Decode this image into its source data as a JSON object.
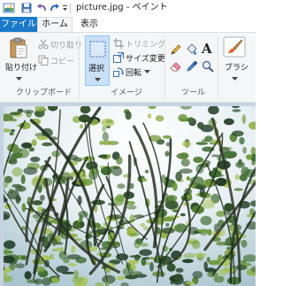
{
  "window": {
    "title": "picture.jpg - ペイント"
  },
  "quick_access": {
    "icons": [
      "paint-app-icon",
      "save-icon",
      "undo-icon",
      "redo-icon",
      "customize-dropdown-icon"
    ]
  },
  "tabs": {
    "file": "ファイル",
    "home": "ホーム",
    "view": "表示"
  },
  "ribbon": {
    "clipboard": {
      "paste_label": "貼り付け",
      "cut_label": "切り取り",
      "copy_label": "コピー",
      "group_label": "クリップボード"
    },
    "image": {
      "select_label": "選択",
      "crop_label": "トリミング",
      "resize_label": "サイズ変更",
      "rotate_label": "回転",
      "group_label": "イメージ"
    },
    "tools": {
      "icons": [
        "pencil-icon",
        "fill-icon",
        "text-icon",
        "eraser-icon",
        "color-picker-icon",
        "magnifier-icon"
      ],
      "text_tool_glyph": "A",
      "group_label": "ツール"
    },
    "brushes": {
      "label": "ブラシ"
    }
  },
  "colors": {
    "file_tab": "#1979ca",
    "ribbon_bg": "#f5f6f7",
    "selected_button": "#c9e0f7",
    "canvas_bg": "#c6d3e2"
  }
}
